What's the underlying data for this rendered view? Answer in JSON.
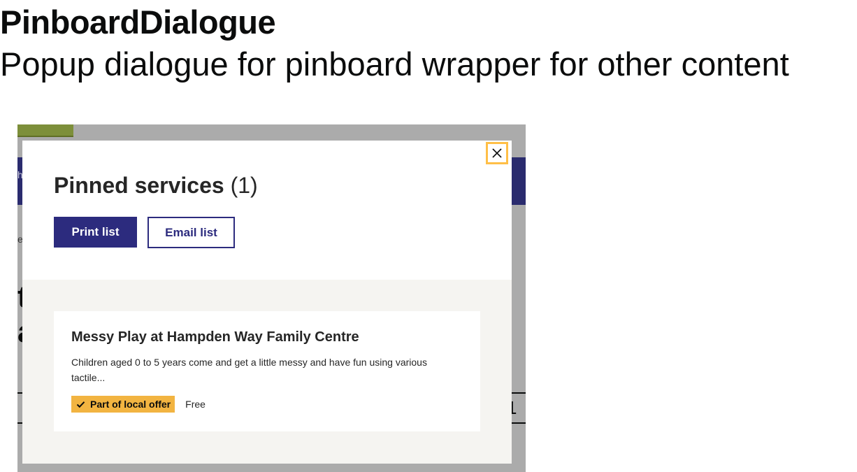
{
  "doc": {
    "title": "PinboardDialogue",
    "subtitle": "Popup dialogue for pinboard wrapper for other content"
  },
  "backdrop": {
    "header_fragment": "h",
    "text_fragment": "e",
    "heading_fragment_1": "t",
    "heading_fragment_2": "a",
    "row_fragment": "1"
  },
  "dialog": {
    "title": "Pinned services",
    "count": "(1)",
    "close_icon": "close-x-icon",
    "buttons": {
      "print_label": "Print list",
      "email_label": "Email list"
    },
    "services": [
      {
        "title": "Messy Play at Hampden Way Family Centre",
        "description": "Children aged 0 to 5 years come and get a little messy and have fun using various tactile...",
        "badge": "Part of local offer",
        "badge_icon": "check-icon",
        "cost": "Free"
      }
    ]
  },
  "colors": {
    "primary": "#2c2b7e",
    "badge": "#f2b441",
    "focus": "#ffbf47",
    "backdrop": "#ababab",
    "list_background": "#f5f4f1"
  }
}
